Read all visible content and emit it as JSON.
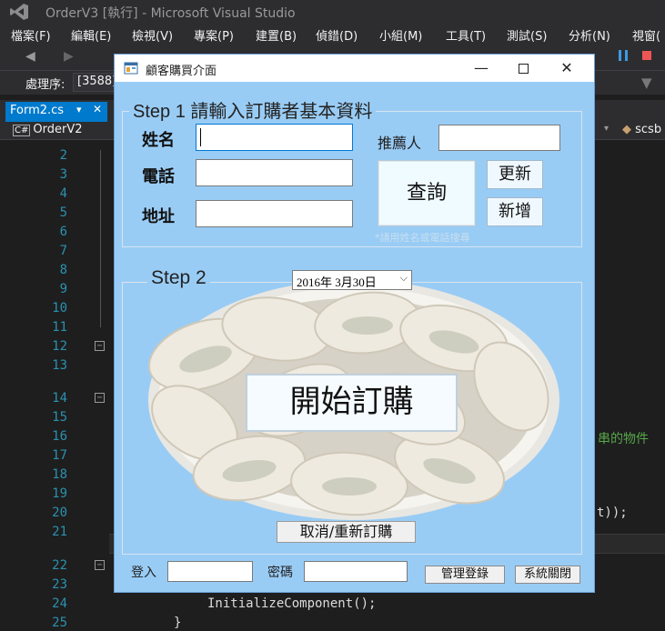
{
  "vs": {
    "title": "OrderV3 [執行] - Microsoft Visual Studio",
    "menu": [
      "檔案(F)",
      "編輯(E)",
      "檢視(V)",
      "專案(P)",
      "建置(B)",
      "偵錯(D)",
      "小組(M)",
      "工具(T)",
      "測試(S)",
      "分析(N)",
      "視窗("
    ],
    "process_label": "處理序:",
    "process_value": "[3588]",
    "tab_label": "Form2.cs",
    "project": "OrderV2",
    "nav_right": "scsb",
    "line_numbers": [
      "2",
      "3",
      "4",
      "5",
      "6",
      "7",
      "8",
      "9",
      "10",
      "11",
      "12",
      "13",
      "14",
      "15",
      "16",
      "17",
      "18",
      "19",
      "20",
      "21",
      "22",
      "23",
      "24",
      "25"
    ],
    "code_fragments": {
      "comment_tail": "串的物件",
      "paren_tail": "t));",
      "init": "InitializeComponent();",
      "brace": "}"
    },
    "accent": "#007acc"
  },
  "form": {
    "title": "顧客購買介面",
    "step1_caption": "Step 1 請輸入訂購者基本資料",
    "name_label": "姓名",
    "phone_label": "電話",
    "address_label": "地址",
    "referrer_label": "推薦人",
    "query_button": "查詢",
    "update_button": "更新",
    "add_button": "新增",
    "hint": "*請用姓名或電話搜尋",
    "step2_caption": "Step 2",
    "date_value": "2016年  3月30日",
    "start_button": "開始訂購",
    "cancel_button": "取消/重新訂購",
    "login_label": "登入",
    "password_label": "密碼",
    "admin_login_button": "管理登錄",
    "close_system_button": "系統關閉",
    "background": "#99ccf5"
  }
}
